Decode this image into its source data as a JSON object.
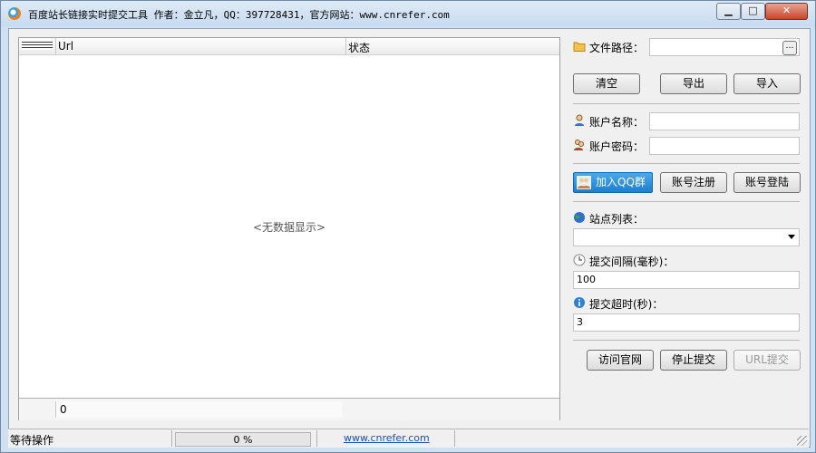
{
  "window": {
    "title": "百度站长链接实时提交工具 作者：金立凡，QQ：397728431，官方网站：www.cnrefer.com",
    "minimize": "▁",
    "maximize": "□",
    "close": "✕"
  },
  "grid": {
    "columns": [
      "Url",
      "状态"
    ],
    "empty_text": "<无数据显示>",
    "footer_value": "0"
  },
  "panel": {
    "file_path_label": "文件路径：",
    "file_path_value": "",
    "browse": "…",
    "clear": "清空",
    "export": "导出",
    "import": "导入",
    "account_name_label": "账户名称：",
    "account_name_value": "",
    "account_password_label": "账户密码：",
    "account_password_value": "",
    "join_qq": "加入QQ群",
    "register": "账号注册",
    "login": "账号登陆",
    "site_list_label": "站点列表：",
    "site_list_value": "",
    "interval_label": "提交间隔(毫秒)：",
    "interval_value": "100",
    "timeout_label": "提交超时(秒)：",
    "timeout_value": "3",
    "visit_site": "访问官网",
    "stop_submit": "停止提交",
    "url_submit": "URL提交"
  },
  "status": {
    "text": "等待操作",
    "progress_percent": 0,
    "progress_label": "0 %",
    "link": "www.cnrefer.com"
  },
  "colors": {
    "accent": "#1c7fd0",
    "link": "#1a4fbf",
    "progress": "#43b03c"
  },
  "icons": {
    "folder": "folder-icon",
    "user": "user-icon",
    "users": "users-icon",
    "qq": "qq-icon",
    "globe": "globe-icon",
    "clock": "clock-icon",
    "info": "info-icon"
  }
}
